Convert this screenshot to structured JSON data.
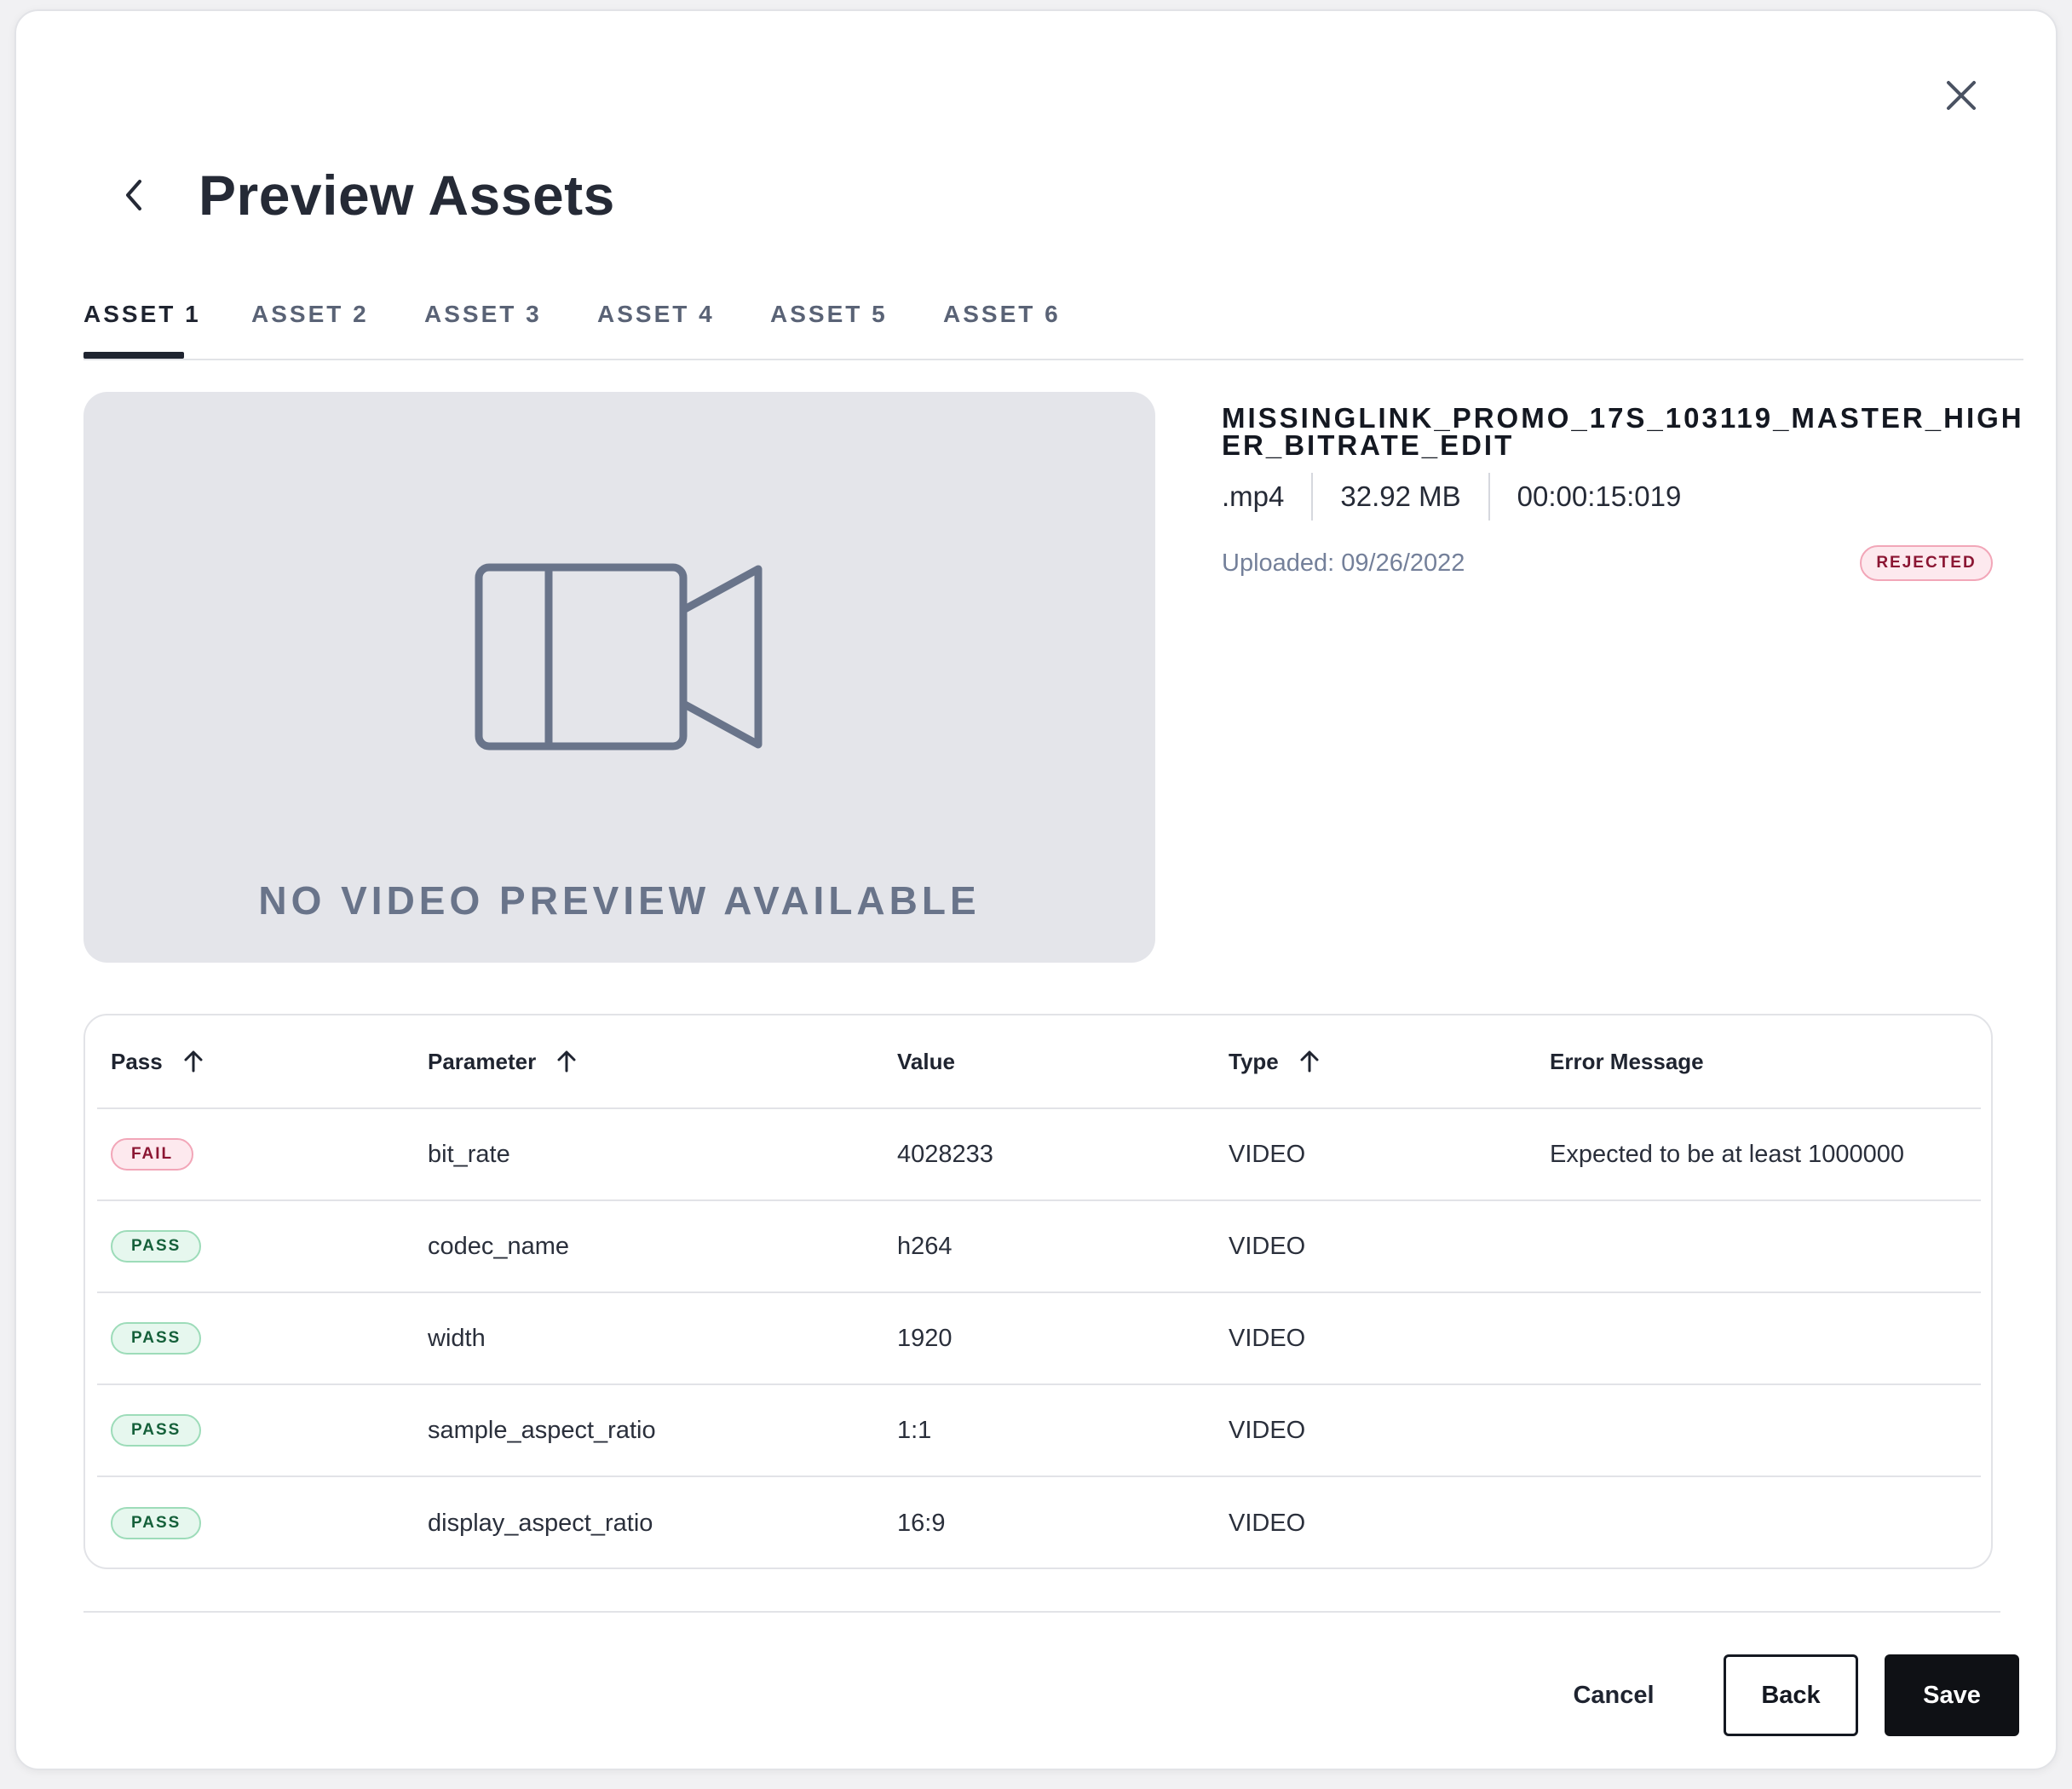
{
  "header": {
    "title": "Preview Assets"
  },
  "tabs": [
    {
      "label": "ASSET 1",
      "active": true
    },
    {
      "label": "ASSET 2",
      "active": false
    },
    {
      "label": "ASSET 3",
      "active": false
    },
    {
      "label": "ASSET 4",
      "active": false
    },
    {
      "label": "ASSET 5",
      "active": false
    },
    {
      "label": "ASSET 6",
      "active": false
    }
  ],
  "preview": {
    "empty_text": "NO VIDEO PREVIEW AVAILABLE",
    "icon": "video-camera-icon"
  },
  "asset": {
    "file_name": "MISSINGLINK_PROMO_17S_103119_MASTER_HIGHER_BITRATE_EDIT",
    "extension": ".mp4",
    "size": "32.92 MB",
    "duration": "00:00:15:019",
    "uploaded": "Uploaded: 09/26/2022",
    "status": "REJECTED"
  },
  "table": {
    "columns": {
      "pass": "Pass",
      "parameter": "Parameter",
      "value": "Value",
      "type": "Type",
      "error": "Error Message"
    },
    "rows": [
      {
        "pass": "FAIL",
        "parameter": "bit_rate",
        "value": "4028233",
        "type": "VIDEO",
        "error": "Expected to be at least 1000000"
      },
      {
        "pass": "PASS",
        "parameter": "codec_name",
        "value": "h264",
        "type": "VIDEO",
        "error": ""
      },
      {
        "pass": "PASS",
        "parameter": "width",
        "value": "1920",
        "type": "VIDEO",
        "error": ""
      },
      {
        "pass": "PASS",
        "parameter": "sample_aspect_ratio",
        "value": "1:1",
        "type": "VIDEO",
        "error": ""
      },
      {
        "pass": "PASS",
        "parameter": "display_aspect_ratio",
        "value": "16:9",
        "type": "VIDEO",
        "error": ""
      }
    ]
  },
  "footer": {
    "cancel": "Cancel",
    "back": "Back",
    "save": "Save"
  },
  "colors": {
    "primary": "#0f1115",
    "fail_bg": "#fde9ee",
    "fail_text": "#8b1633",
    "pass_bg": "#e6f7ee",
    "pass_text": "#15603a",
    "preview_bg": "#e4e5ea",
    "icon_slate": "#69748a"
  }
}
